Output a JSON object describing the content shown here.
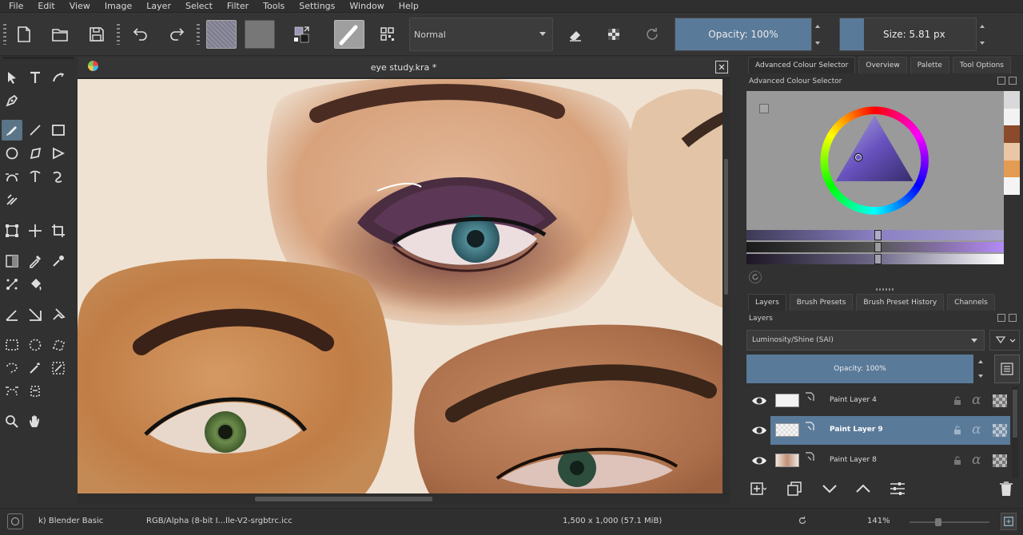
{
  "menu": [
    "File",
    "Edit",
    "View",
    "Image",
    "Layer",
    "Select",
    "Filter",
    "Tools",
    "Settings",
    "Window",
    "Help"
  ],
  "toolbar": {
    "blend_mode": "Normal",
    "opacity_label": "Opacity: 100%",
    "opacity_value": 1.0,
    "size_label": "Size: 5.81 px"
  },
  "document": {
    "tab_title": "eye study.kra *",
    "close_glyph": "✕"
  },
  "dock": {
    "top_tabs": [
      "Advanced Colour Selector",
      "Overview",
      "Palette",
      "Tool Options"
    ],
    "color_panel_title": "Advanced Colour Selector",
    "palette_colors": [
      "#d9d9dc",
      "#f2f2f2",
      "#8b4a2c",
      "#eac6a5",
      "#e49b52",
      "#f4f4f4"
    ],
    "layer_tabs": [
      "Layers",
      "Brush Presets",
      "Brush Preset History",
      "Channels"
    ],
    "layers_title": "Layers",
    "layer_blend_mode": "Luminosity/Shine (SAI)",
    "layer_opacity_label": "Opacity:  100%",
    "layers": [
      {
        "name": "Paint Layer 4",
        "selected": false
      },
      {
        "name": "Paint Layer 9",
        "selected": true
      },
      {
        "name": "Paint Layer 8",
        "selected": false
      }
    ],
    "alpha_glyph": "α"
  },
  "status": {
    "brush_preset": "k) Blender Basic",
    "color_profile": "RGB/Alpha (8-bit I...lle-V2-srgbtrc.icc",
    "image_size": "1,500 x 1,000 (57.1 MiB)",
    "zoom": "141%"
  },
  "colors": {
    "accent": "#5a7a99",
    "background": "#313131"
  }
}
